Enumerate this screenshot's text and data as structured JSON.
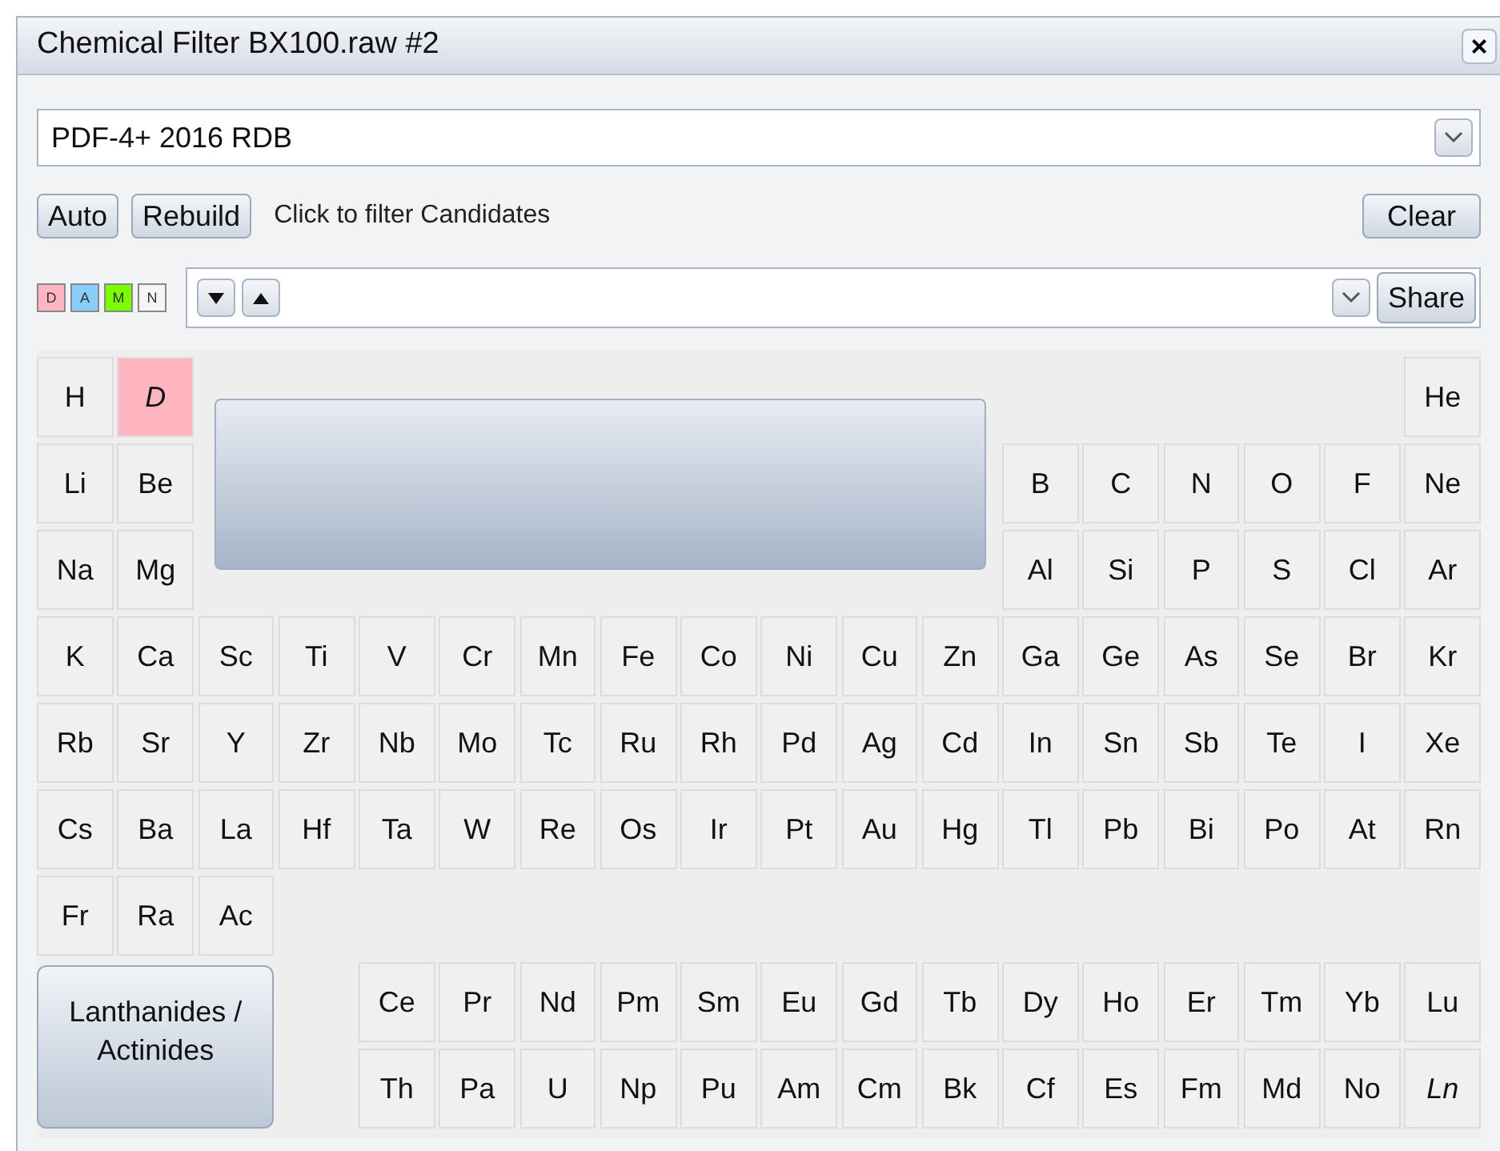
{
  "window": {
    "title": "Chemical Filter BX100.raw #2",
    "close": "×"
  },
  "database": {
    "value": "PDF-4+ 2016 RDB"
  },
  "buttons": {
    "auto": "Auto",
    "rebuild": "Rebuild",
    "hint": "Click to filter Candidates",
    "clear": "Clear"
  },
  "legend": [
    {
      "label": "D",
      "color": "#ffb6c1"
    },
    {
      "label": "A",
      "color": "#87cefa"
    },
    {
      "label": "M",
      "color": "#7cfc00"
    },
    {
      "label": "N",
      "color": "#f4f4f4"
    }
  ],
  "filter": {
    "share": "Share"
  },
  "table": {
    "rows": [
      {
        "left": [
          {
            "symbol": "H",
            "kind": "element",
            "selected": false
          },
          {
            "symbol": "D",
            "kind": "special",
            "selected": true
          }
        ],
        "right": [
          {
            "symbol": "He",
            "kind": "element",
            "selected": false
          }
        ]
      },
      {
        "left": [
          {
            "symbol": "Li",
            "kind": "element",
            "selected": false
          },
          {
            "symbol": "Be",
            "kind": "element",
            "selected": false
          }
        ],
        "right": [
          {
            "symbol": "B",
            "kind": "element",
            "selected": false
          },
          {
            "symbol": "C",
            "kind": "element",
            "selected": false
          },
          {
            "symbol": "N",
            "kind": "element",
            "selected": false
          },
          {
            "symbol": "O",
            "kind": "element",
            "selected": false
          },
          {
            "symbol": "F",
            "kind": "element",
            "selected": false
          },
          {
            "symbol": "Ne",
            "kind": "element",
            "selected": false
          }
        ]
      },
      {
        "left": [
          {
            "symbol": "Na",
            "kind": "element",
            "selected": false
          },
          {
            "symbol": "Mg",
            "kind": "element",
            "selected": false
          }
        ],
        "right": [
          {
            "symbol": "Al",
            "kind": "element",
            "selected": false
          },
          {
            "symbol": "Si",
            "kind": "element",
            "selected": false
          },
          {
            "symbol": "P",
            "kind": "element",
            "selected": false
          },
          {
            "symbol": "S",
            "kind": "element",
            "selected": false
          },
          {
            "symbol": "Cl",
            "kind": "element",
            "selected": false
          },
          {
            "symbol": "Ar",
            "kind": "element",
            "selected": false
          }
        ]
      },
      {
        "left": [
          {
            "symbol": "K",
            "kind": "element",
            "selected": false
          },
          {
            "symbol": "Ca",
            "kind": "element",
            "selected": false
          },
          {
            "symbol": "Sc",
            "kind": "element",
            "selected": false
          },
          {
            "symbol": "Ti",
            "kind": "element",
            "selected": false
          },
          {
            "symbol": "V",
            "kind": "element",
            "selected": false
          },
          {
            "symbol": "Cr",
            "kind": "element",
            "selected": false
          },
          {
            "symbol": "Mn",
            "kind": "element",
            "selected": false
          },
          {
            "symbol": "Fe",
            "kind": "element",
            "selected": false
          },
          {
            "symbol": "Co",
            "kind": "element",
            "selected": false
          },
          {
            "symbol": "Ni",
            "kind": "element",
            "selected": false
          },
          {
            "symbol": "Cu",
            "kind": "element",
            "selected": false
          },
          {
            "symbol": "Zn",
            "kind": "element",
            "selected": false
          },
          {
            "symbol": "Ga",
            "kind": "element",
            "selected": false
          },
          {
            "symbol": "Ge",
            "kind": "element",
            "selected": false
          },
          {
            "symbol": "As",
            "kind": "element",
            "selected": false
          },
          {
            "symbol": "Se",
            "kind": "element",
            "selected": false
          },
          {
            "symbol": "Br",
            "kind": "element",
            "selected": false
          },
          {
            "symbol": "Kr",
            "kind": "element",
            "selected": false
          }
        ],
        "right": []
      },
      {
        "left": [
          {
            "symbol": "Rb",
            "kind": "element",
            "selected": false
          },
          {
            "symbol": "Sr",
            "kind": "element",
            "selected": false
          },
          {
            "symbol": "Y",
            "kind": "element",
            "selected": false
          },
          {
            "symbol": "Zr",
            "kind": "element",
            "selected": false
          },
          {
            "symbol": "Nb",
            "kind": "element",
            "selected": false
          },
          {
            "symbol": "Mo",
            "kind": "element",
            "selected": false
          },
          {
            "symbol": "Tc",
            "kind": "element",
            "selected": false
          },
          {
            "symbol": "Ru",
            "kind": "element",
            "selected": false
          },
          {
            "symbol": "Rh",
            "kind": "element",
            "selected": false
          },
          {
            "symbol": "Pd",
            "kind": "element",
            "selected": false
          },
          {
            "symbol": "Ag",
            "kind": "element",
            "selected": false
          },
          {
            "symbol": "Cd",
            "kind": "element",
            "selected": false
          },
          {
            "symbol": "In",
            "kind": "element",
            "selected": false
          },
          {
            "symbol": "Sn",
            "kind": "element",
            "selected": false
          },
          {
            "symbol": "Sb",
            "kind": "element",
            "selected": false
          },
          {
            "symbol": "Te",
            "kind": "element",
            "selected": false
          },
          {
            "symbol": "I",
            "kind": "element",
            "selected": false
          },
          {
            "symbol": "Xe",
            "kind": "element",
            "selected": false
          }
        ],
        "right": []
      },
      {
        "left": [
          {
            "symbol": "Cs",
            "kind": "element",
            "selected": false
          },
          {
            "symbol": "Ba",
            "kind": "element",
            "selected": false
          },
          {
            "symbol": "La",
            "kind": "element",
            "selected": false
          },
          {
            "symbol": "Hf",
            "kind": "element",
            "selected": false
          },
          {
            "symbol": "Ta",
            "kind": "element",
            "selected": false
          },
          {
            "symbol": "W",
            "kind": "element",
            "selected": false
          },
          {
            "symbol": "Re",
            "kind": "element",
            "selected": false
          },
          {
            "symbol": "Os",
            "kind": "element",
            "selected": false
          },
          {
            "symbol": "Ir",
            "kind": "element",
            "selected": false
          },
          {
            "symbol": "Pt",
            "kind": "element",
            "selected": false
          },
          {
            "symbol": "Au",
            "kind": "element",
            "selected": false
          },
          {
            "symbol": "Hg",
            "kind": "element",
            "selected": false
          },
          {
            "symbol": "Tl",
            "kind": "element",
            "selected": false
          },
          {
            "symbol": "Pb",
            "kind": "element",
            "selected": false
          },
          {
            "symbol": "Bi",
            "kind": "element",
            "selected": false
          },
          {
            "symbol": "Po",
            "kind": "element",
            "selected": false
          },
          {
            "symbol": "At",
            "kind": "element",
            "selected": false
          },
          {
            "symbol": "Rn",
            "kind": "element",
            "selected": false
          }
        ],
        "right": []
      },
      {
        "left": [
          {
            "symbol": "Fr",
            "kind": "element",
            "selected": false
          },
          {
            "symbol": "Ra",
            "kind": "element",
            "selected": false
          },
          {
            "symbol": "Ac",
            "kind": "element",
            "selected": false
          }
        ],
        "right": []
      },
      {
        "left": [],
        "right": [
          {
            "symbol": "Ce",
            "kind": "element",
            "selected": false
          },
          {
            "symbol": "Pr",
            "kind": "element",
            "selected": false
          },
          {
            "symbol": "Nd",
            "kind": "element",
            "selected": false
          },
          {
            "symbol": "Pm",
            "kind": "element",
            "selected": false
          },
          {
            "symbol": "Sm",
            "kind": "element",
            "selected": false
          },
          {
            "symbol": "Eu",
            "kind": "element",
            "selected": false
          },
          {
            "symbol": "Gd",
            "kind": "element",
            "selected": false
          },
          {
            "symbol": "Tb",
            "kind": "element",
            "selected": false
          },
          {
            "symbol": "Dy",
            "kind": "element",
            "selected": false
          },
          {
            "symbol": "Ho",
            "kind": "element",
            "selected": false
          },
          {
            "symbol": "Er",
            "kind": "element",
            "selected": false
          },
          {
            "symbol": "Tm",
            "kind": "element",
            "selected": false
          },
          {
            "symbol": "Yb",
            "kind": "element",
            "selected": false
          },
          {
            "symbol": "Lu",
            "kind": "element",
            "selected": false
          }
        ]
      },
      {
        "left": [],
        "right": [
          {
            "symbol": "Th",
            "kind": "element",
            "selected": false
          },
          {
            "symbol": "Pa",
            "kind": "element",
            "selected": false
          },
          {
            "symbol": "U",
            "kind": "element",
            "selected": false
          },
          {
            "symbol": "Np",
            "kind": "element",
            "selected": false
          },
          {
            "symbol": "Pu",
            "kind": "element",
            "selected": false
          },
          {
            "symbol": "Am",
            "kind": "element",
            "selected": false
          },
          {
            "symbol": "Cm",
            "kind": "element",
            "selected": false
          },
          {
            "symbol": "Bk",
            "kind": "element",
            "selected": false
          },
          {
            "symbol": "Cf",
            "kind": "element",
            "selected": false
          },
          {
            "symbol": "Es",
            "kind": "element",
            "selected": false
          },
          {
            "symbol": "Fm",
            "kind": "element",
            "selected": false
          },
          {
            "symbol": "Md",
            "kind": "element",
            "selected": false
          },
          {
            "symbol": "No",
            "kind": "element",
            "selected": false
          },
          {
            "symbol": "Ln",
            "kind": "special",
            "selected": false
          }
        ]
      }
    ],
    "series_button": "Lanthanides / Actinides"
  }
}
